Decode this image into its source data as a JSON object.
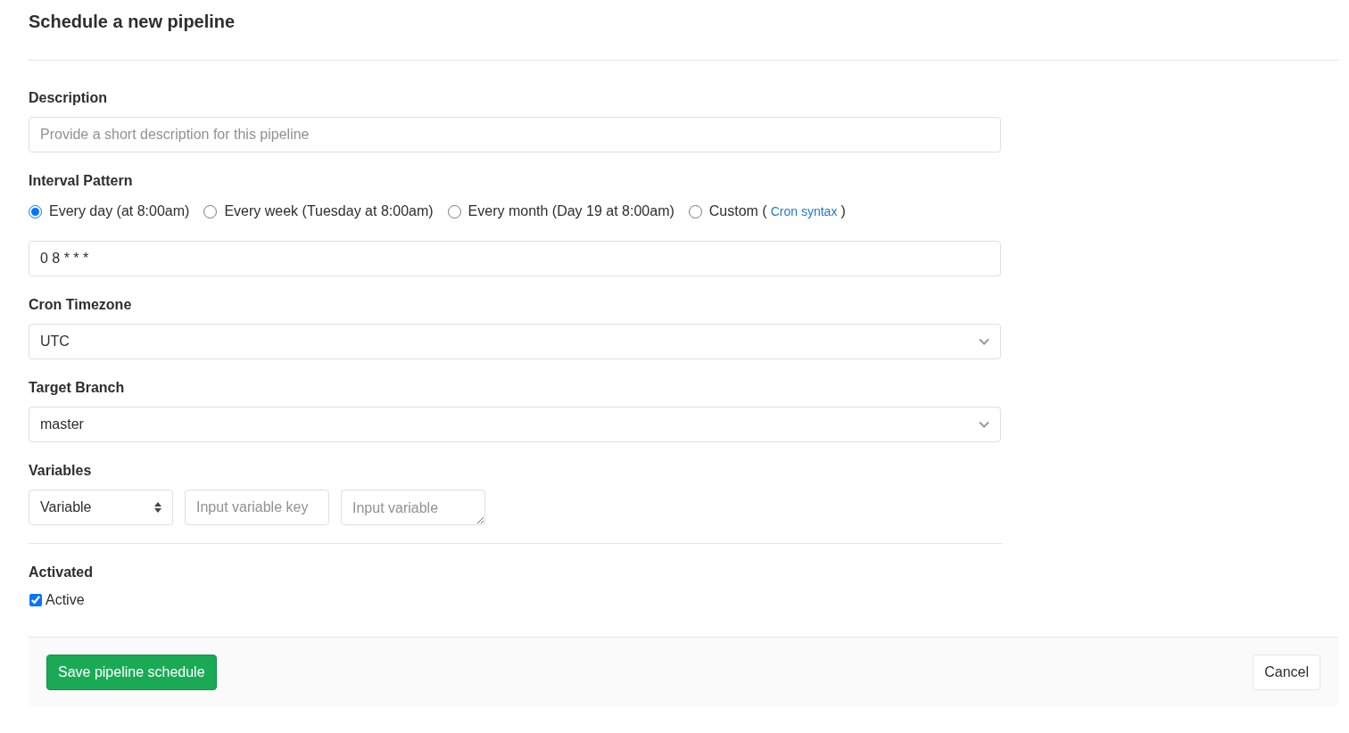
{
  "title": "Schedule a new pipeline",
  "description": {
    "label": "Description",
    "placeholder": "Provide a short description for this pipeline"
  },
  "interval": {
    "label": "Interval Pattern",
    "value": "0 8 * * *",
    "options": [
      {
        "label": "Every day (at 8:00am)",
        "selected": true
      },
      {
        "label": "Every week (Tuesday at 8:00am)",
        "selected": false
      },
      {
        "label": "Every month (Day 19 at 8:00am)",
        "selected": false
      },
      {
        "label": "Custom (",
        "link": "Cron syntax",
        "suffix": ")",
        "selected": false
      }
    ]
  },
  "timezone": {
    "label": "Cron Timezone",
    "value": "UTC"
  },
  "branch": {
    "label": "Target Branch",
    "value": "master"
  },
  "variables": {
    "label": "Variables",
    "type": "Variable",
    "key_placeholder": "Input variable key",
    "value_placeholder": "Input variable"
  },
  "activated": {
    "label": "Activated",
    "checkbox": "Active",
    "checked": true
  },
  "buttons": {
    "save": "Save pipeline schedule",
    "cancel": "Cancel"
  }
}
